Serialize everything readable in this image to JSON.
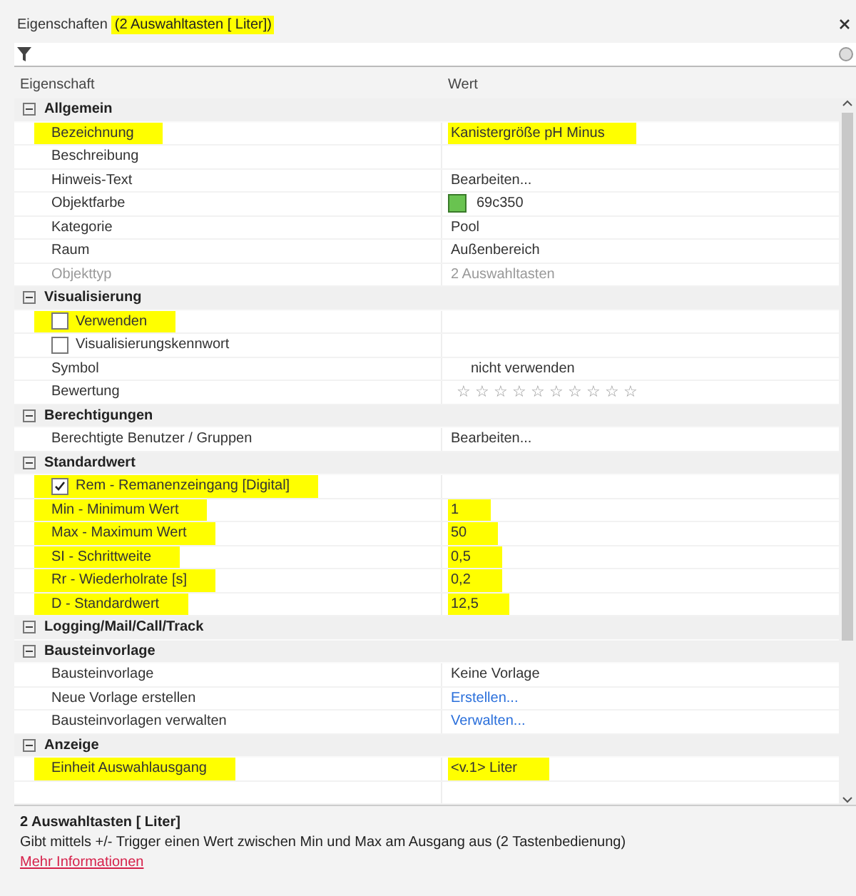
{
  "panel": {
    "title": "Eigenschaften",
    "selection": "(2 Auswahltasten [ Liter])",
    "selection_highlighted": true
  },
  "columns": [
    "Eigenschaft",
    "Wert"
  ],
  "groups": [
    {
      "name": "Allgemein",
      "rows": [
        {
          "kind": "text",
          "label": "Bezeichnung",
          "value": "Kanistergröße pH Minus",
          "highlighted": true,
          "disabled": false
        },
        {
          "kind": "text",
          "label": "Beschreibung",
          "highlighted": false,
          "disabled": false
        },
        {
          "kind": "text",
          "label": "Hinweis-Text",
          "value": "Bearbeiten...",
          "highlighted": false,
          "disabled": false
        },
        {
          "kind": "color",
          "label": "Objektfarbe",
          "value": "69c350",
          "color": "#69c350",
          "highlighted": false,
          "disabled": false
        },
        {
          "kind": "text",
          "label": "Kategorie",
          "value": "Pool",
          "highlighted": false,
          "disabled": false
        },
        {
          "kind": "text",
          "label": "Raum",
          "value": "Außenbereich",
          "highlighted": false,
          "disabled": false
        },
        {
          "kind": "text",
          "label": "Objekttyp",
          "value": "2 Auswahltasten",
          "highlighted": false,
          "disabled": true
        }
      ]
    },
    {
      "name": "Visualisierung",
      "rows": [
        {
          "kind": "checkbox",
          "label": "Verwenden",
          "checked": false,
          "highlighted": true,
          "disabled": false
        },
        {
          "kind": "checkbox",
          "label": "Visualisierungskennwort",
          "checked": false,
          "highlighted": false,
          "disabled": false
        },
        {
          "kind": "symbol",
          "label": "Symbol",
          "value": "nicht verwenden",
          "highlighted": false,
          "disabled": false
        },
        {
          "kind": "stars",
          "label": "Bewertung",
          "stars": 0,
          "highlighted": false,
          "disabled": false
        }
      ]
    },
    {
      "name": "Berechtigungen",
      "rows": [
        {
          "kind": "text",
          "label": "Berechtigte Benutzer / Gruppen",
          "value": "Bearbeiten...",
          "highlighted": false,
          "disabled": false
        }
      ]
    },
    {
      "name": "Standardwert",
      "rows": [
        {
          "kind": "checkbox",
          "label": "Rem - Remanenzeingang [Digital]",
          "checked": true,
          "highlighted": true,
          "disabled": false
        },
        {
          "kind": "text",
          "label": "Min - Minimum Wert",
          "value": "1",
          "highlighted": true,
          "disabled": false
        },
        {
          "kind": "text",
          "label": "Max - Maximum Wert",
          "value": "50",
          "highlighted": true,
          "disabled": false
        },
        {
          "kind": "text",
          "label": "SI - Schrittweite",
          "value": "0,5",
          "highlighted": true,
          "disabled": false
        },
        {
          "kind": "text",
          "label": "Rr - Wiederholrate [s]",
          "value": "0,2",
          "highlighted": true,
          "disabled": false
        },
        {
          "kind": "text",
          "label": "D - Standardwert",
          "value": "12,5",
          "highlighted": true,
          "disabled": false
        }
      ]
    },
    {
      "name": "Logging/Mail/Call/Track"
    },
    {
      "name": "Bausteinvorlage",
      "rows": [
        {
          "kind": "text",
          "label": "Bausteinvorlage",
          "value": "Keine Vorlage",
          "highlighted": false,
          "disabled": false
        },
        {
          "kind": "link",
          "label": "Neue Vorlage erstellen",
          "value": "Erstellen...",
          "highlighted": false,
          "disabled": false
        },
        {
          "kind": "link",
          "label": "Bausteinvorlagen verwalten",
          "value": "Verwalten...",
          "highlighted": false,
          "disabled": false
        }
      ]
    },
    {
      "name": "Anzeige",
      "rows": [
        {
          "kind": "text",
          "label": "Einheit Auswahlausgang",
          "value": "<v.1> Liter",
          "highlighted": true,
          "disabled": false
        }
      ]
    }
  ],
  "description": {
    "title": "2 Auswahltasten [ Liter]",
    "text": "Gibt mittels +/- Trigger einen Wert zwischen Min und Max am Ausgang aus (2 Tastenbedienung)",
    "link": "Mehr Informationen"
  }
}
